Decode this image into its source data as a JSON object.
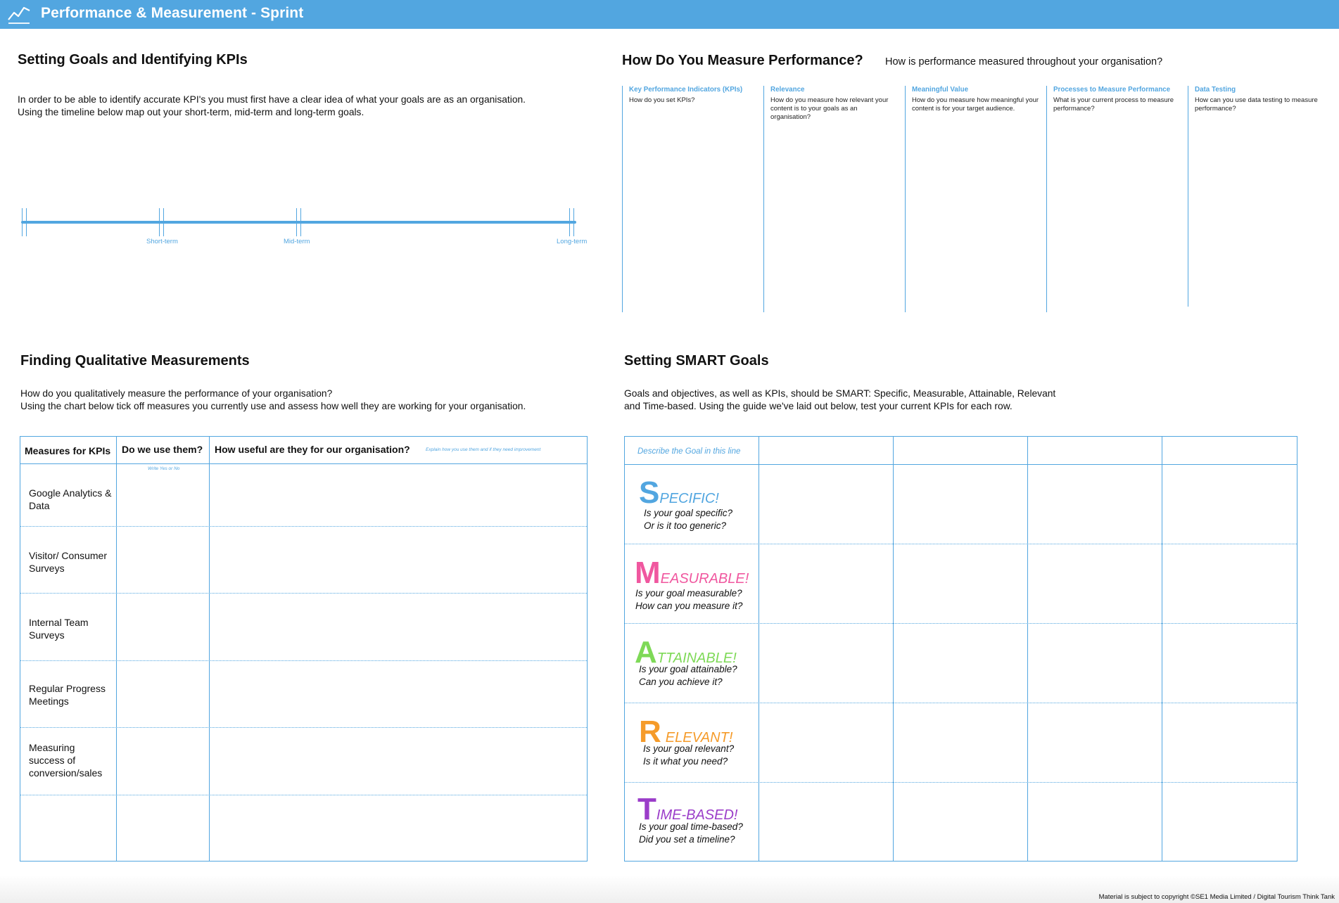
{
  "header": {
    "title": "Performance & Measurement - Sprint",
    "color": "#52a6e0"
  },
  "goals_section": {
    "title": "Setting Goals and Identifying KPIs",
    "text_line1": "In order to be able to identify accurate KPI's you must first have a clear idea of what your goals are as an organisation.",
    "text_line2": "Using the timeline below map out your short-term, mid-term and long-term goals.",
    "timeline_labels": [
      "Short-term",
      "Mid-term",
      "Long-term"
    ]
  },
  "measure_section": {
    "title": "How Do You Measure Performance?",
    "subtitle": "How is performance measured throughout your organisation?",
    "columns": [
      {
        "caption": "Key Performance Indicators (KPIs)",
        "question": "How do you set KPIs?"
      },
      {
        "caption": "Relevance",
        "question": "How do you measure how relevant your content is to your goals as an organisation?"
      },
      {
        "caption": "Meaningful Value",
        "question": "How do you measure how meaningful your content is for your target audience."
      },
      {
        "caption": "Processes to Measure Performance",
        "question": "What is your current process to measure performance?"
      },
      {
        "caption": "Data Testing",
        "question": "How can you use data testing to measure performance?"
      }
    ]
  },
  "qualitative_section": {
    "title": "Finding Qualitative Measurements",
    "text_line1": "How do you qualitatively measure the performance of your organisation?",
    "text_line2": "Using the chart below tick off measures you currently use and assess how well they are working for your organisation.",
    "table": {
      "headers": [
        "Measures for KPIs",
        "Do we use them?",
        "How useful are they for our organisation?"
      ],
      "use_hint": "Write Yes or No",
      "useful_hint": "Explain how you use them and if they need improvement",
      "rows": [
        "Google Analytics & Data",
        "Visitor/ Consumer Surveys",
        "Internal Team Surveys",
        "Regular Progress Meetings",
        "Measuring success of conversion/sales",
        ""
      ]
    }
  },
  "smart_section": {
    "title": "Setting SMART Goals",
    "text_line1": "Goals and objectives, as well as KPIs, should be SMART: Specific, Measurable, Attainable, Relevant",
    "text_line2": "and Time-based. Using the guide we've laid out below, test your current KPIs for each row.",
    "goal_hint": "Describe the Goal in this line",
    "rows": [
      {
        "letter": "S",
        "rest": "PECIFIC!",
        "color": "#52a6e0",
        "line1": "Is your goal specific?",
        "line2": "Or is it too generic?"
      },
      {
        "letter": "M",
        "rest": "EASURABLE!",
        "color": "#f0579f",
        "line1": "Is your goal measurable?",
        "line2": "How can you measure it?"
      },
      {
        "letter": "A",
        "rest": "TTAINABLE!",
        "color": "#7ed957",
        "line1": "Is your goal attainable?",
        "line2": "Can you achieve it?"
      },
      {
        "letter": "R",
        "rest": "ELEVANT!",
        "color": "#f59b2a",
        "line1": "Is your goal relevant?",
        "line2": "Is it what you need?"
      },
      {
        "letter": "T",
        "rest": "IME-BASED!",
        "color": "#9b3dc9",
        "line1": "Is your goal time-based?",
        "line2": "Did you set a timeline?"
      }
    ]
  },
  "footer": {
    "copyright": "Material is subject to copyright ©SE1 Media Limited / Digital Tourism Think Tank"
  }
}
